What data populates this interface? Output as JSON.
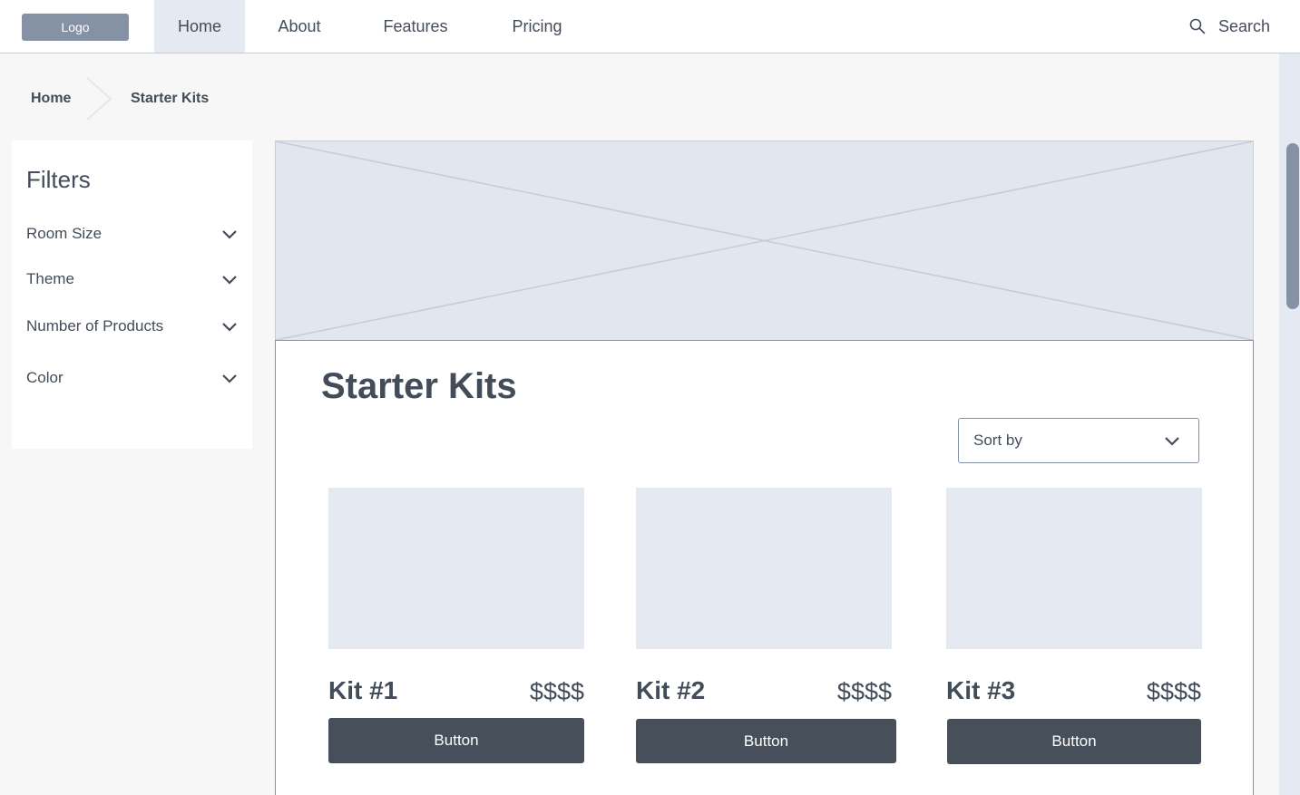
{
  "nav": {
    "logo": "Logo",
    "tabs": [
      {
        "label": "Home",
        "active": true
      },
      {
        "label": "About",
        "active": false
      },
      {
        "label": "Features",
        "active": false
      },
      {
        "label": "Pricing",
        "active": false
      }
    ],
    "search_label": "Search",
    "search_icon": "search-icon"
  },
  "breadcrumb": {
    "items": [
      "Home",
      "Starter Kits"
    ],
    "separator_icon": "chevron-right-icon"
  },
  "filters": {
    "title": "Filters",
    "items": [
      "Room Size",
      "Theme",
      "Number of Products",
      "Color"
    ],
    "toggle_icon": "chevron-down-icon"
  },
  "main": {
    "title": "Starter Kits",
    "sort": {
      "label": "Sort by",
      "icon": "chevron-down-icon"
    },
    "kits": [
      {
        "name": "Kit #1",
        "price": "$$$$",
        "button": "Button"
      },
      {
        "name": "Kit #2",
        "price": "$$$$",
        "button": "Button"
      },
      {
        "name": "Kit #3",
        "price": "$$$$",
        "button": "Button"
      }
    ]
  },
  "colors": {
    "accent_dark": "#474f5a",
    "logo_bg": "#8592a6",
    "active_tab_bg": "#e5eaf2",
    "placeholder_bg": "#e1e6ef",
    "text": "#434c59"
  }
}
